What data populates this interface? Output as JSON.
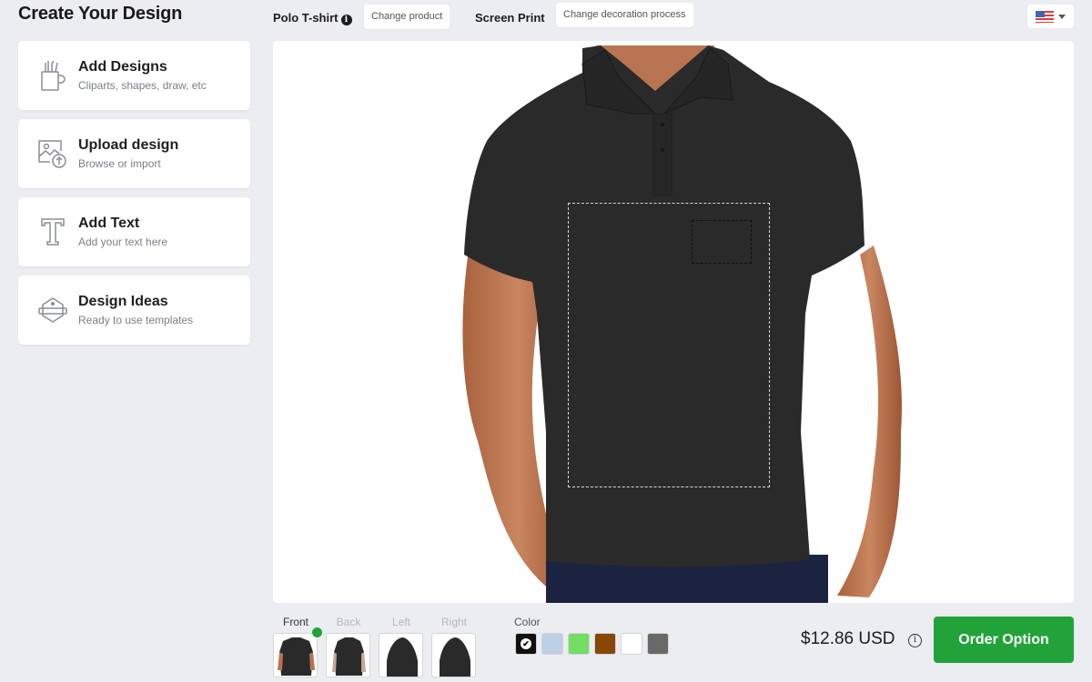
{
  "page": {
    "title": "Create Your Design"
  },
  "tools": [
    {
      "title": "Add Designs",
      "subtitle": "Cliparts, shapes, draw, etc",
      "icon": "pencil-cup-icon"
    },
    {
      "title": "Upload design",
      "subtitle": "Browse or import",
      "icon": "image-upload-icon"
    },
    {
      "title": "Add Text",
      "subtitle": "Add your text here",
      "icon": "text-t-icon"
    },
    {
      "title": "Design Ideas",
      "subtitle": "Ready to use templates",
      "icon": "badge-template-icon"
    }
  ],
  "topbar": {
    "product_name": "Polo T-shirt",
    "change_product_label": "Change product",
    "process_name": "Screen Print",
    "change_process_label": "Change decoration process",
    "locale_flag": "us-flag-icon"
  },
  "views": {
    "selected": "Front",
    "items": [
      {
        "label": "Front"
      },
      {
        "label": "Back"
      },
      {
        "label": "Left"
      },
      {
        "label": "Right"
      }
    ]
  },
  "colors": {
    "label": "Color",
    "selected": "#111111",
    "swatches": [
      "#111111",
      "#bcd0e6",
      "#72df63",
      "#874705",
      "#ffffff",
      "#6b6967"
    ]
  },
  "pricing": {
    "price": "$12.86 USD",
    "info_icon": "i",
    "order_label": "Order Option",
    "accent": "#22a33a"
  },
  "info_glyph": "i",
  "check_glyph": "✔"
}
